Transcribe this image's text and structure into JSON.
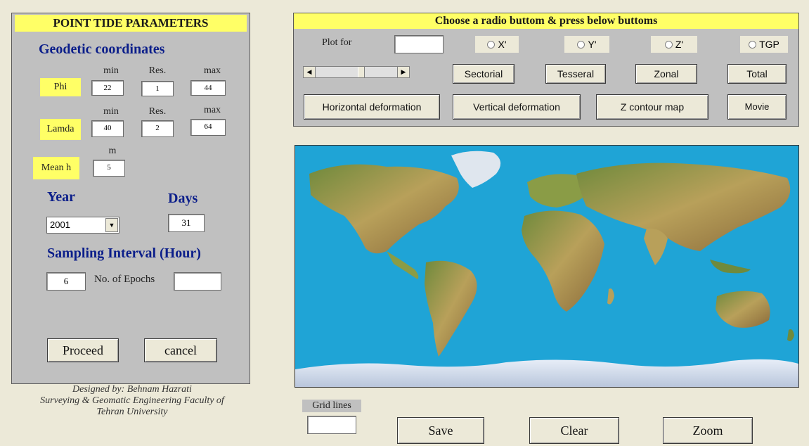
{
  "left_panel": {
    "title": "POINT TIDE PARAMETERS",
    "geodetic_heading": "Geodetic coordinates",
    "col_headers": {
      "min": "min",
      "res": "Res.",
      "max": "max",
      "m": "m"
    },
    "phi": {
      "label": "Phi",
      "min": "22",
      "res": "1",
      "max": "44"
    },
    "lamda": {
      "label": "Lamda",
      "min": "40",
      "res": "2",
      "max": "64"
    },
    "mean_h": {
      "label": "Mean h",
      "value": "5"
    },
    "year_label": "Year",
    "days_label": "Days",
    "year_value": "2001",
    "days_value": "31",
    "sampling_heading": "Sampling Interval (Hour)",
    "sampling_value": "6",
    "epochs_label": "No. of Epochs",
    "epochs_value": "",
    "proceed": "Proceed",
    "cancel": "cancel"
  },
  "credits": {
    "line1": "Designed by: Behnam Hazrati",
    "line2": "Surveying & Geomatic Engineering Faculty of",
    "line3": "Tehran University"
  },
  "top_panel": {
    "title": "Choose a radio buttom & press below buttoms",
    "plot_for_label": "Plot for",
    "plot_for_value": "",
    "radios": [
      "X'",
      "Y'",
      "Z'",
      "TGP"
    ],
    "buttons_row1": [
      "Sectorial",
      "Tesseral",
      "Zonal",
      "Total"
    ],
    "buttons_row2": [
      "Horizontal deformation",
      "Vertical deformation",
      "Z contour map",
      "Movie"
    ],
    "slider_fraction": 0.55
  },
  "bottom": {
    "grid_lines_label": "Grid lines",
    "grid_lines_value": "",
    "save": "Save",
    "clear": "Clear",
    "zoom": "Zoom"
  },
  "colors": {
    "panel": "#C0C0C0",
    "label_yellow": "#FFFF66",
    "heading_blue": "#0b1e8a",
    "ocean": "#1fa4d6",
    "land": "#b8a05a",
    "window": "#ECE9D8"
  }
}
